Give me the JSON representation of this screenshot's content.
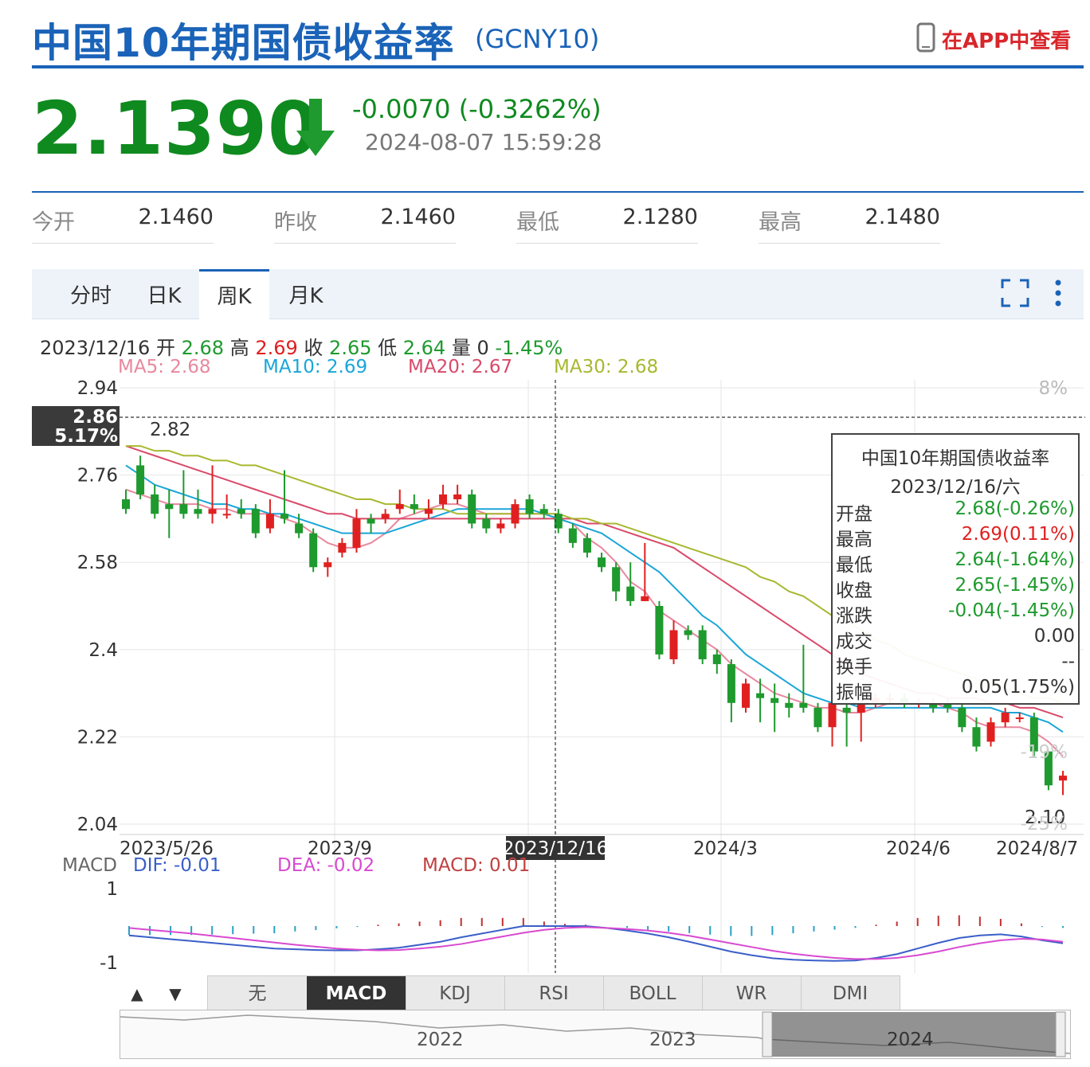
{
  "header": {
    "title": "中国10年期国债收益率",
    "code": "(GCNY10)",
    "app_link": "在APP中查看"
  },
  "quote": {
    "price": "2.1390",
    "direction_icon": "arrow-down-icon",
    "change": "-0.0070 (-0.3262%)",
    "timestamp": "2024-08-07 15:59:28"
  },
  "stats": [
    {
      "label": "今开",
      "value": "2.1460"
    },
    {
      "label": "昨收",
      "value": "2.1460"
    },
    {
      "label": "最低",
      "value": "2.1280"
    },
    {
      "label": "最高",
      "value": "2.1480"
    }
  ],
  "tabs": [
    {
      "label": "分时",
      "active": false
    },
    {
      "label": "日K",
      "active": false
    },
    {
      "label": "周K",
      "active": true
    },
    {
      "label": "月K",
      "active": false
    }
  ],
  "toolbar_icons": [
    "fullscreen-icon",
    "more-vertical-icon"
  ],
  "info_line": {
    "date": "2023/12/16",
    "open_label": "开",
    "open": "2.68",
    "high_label": "高",
    "high": "2.69",
    "close_label": "收",
    "close": "2.65",
    "low_label": "低",
    "low": "2.64",
    "vol_label": "量",
    "vol": "0",
    "pct": "-1.45%"
  },
  "ma_legend": [
    {
      "text": "MA5: 2.68",
      "color": "#e8889e"
    },
    {
      "text": "MA10: 2.69",
      "color": "#1aa6d8"
    },
    {
      "text": "MA20: 2.67",
      "color": "#d94a6a"
    },
    {
      "text": "MA30: 2.68",
      "color": "#a8b830"
    }
  ],
  "colors": {
    "up": "#e02020",
    "down": "#1e9a2e",
    "accent": "#1a63b8"
  },
  "chart_data": {
    "type": "candlestick",
    "y_ticks": [
      "2.94",
      "2.76",
      "2.58",
      "2.4",
      "2.22",
      "2.04"
    ],
    "ylim": [
      2.04,
      2.94
    ],
    "right_pct_labels": [
      "8%",
      "-19%",
      "-25%"
    ],
    "x_labels": [
      "2023/5/26",
      "2023/9",
      "2023/12/16",
      "2024/3",
      "2024/6",
      "2024/8/7"
    ],
    "crosshair": {
      "date": "2023/12/16",
      "value": "2.86",
      "pct": "5.17%"
    },
    "annotations": {
      "max": "2.82",
      "min": "2.10"
    },
    "candles": [
      {
        "o": 2.71,
        "c": 2.69,
        "h": 2.73,
        "l": 2.68
      },
      {
        "o": 2.78,
        "c": 2.72,
        "h": 2.8,
        "l": 2.71
      },
      {
        "o": 2.72,
        "c": 2.68,
        "h": 2.74,
        "l": 2.67
      },
      {
        "o": 2.7,
        "c": 2.69,
        "h": 2.73,
        "l": 2.63
      },
      {
        "o": 2.7,
        "c": 2.68,
        "h": 2.77,
        "l": 2.67
      },
      {
        "o": 2.69,
        "c": 2.68,
        "h": 2.73,
        "l": 2.67
      },
      {
        "o": 2.68,
        "c": 2.69,
        "h": 2.78,
        "l": 2.66
      },
      {
        "o": 2.68,
        "c": 2.68,
        "h": 2.72,
        "l": 2.67
      },
      {
        "o": 2.69,
        "c": 2.68,
        "h": 2.71,
        "l": 2.67
      },
      {
        "o": 2.69,
        "c": 2.64,
        "h": 2.7,
        "l": 2.63
      },
      {
        "o": 2.65,
        "c": 2.68,
        "h": 2.71,
        "l": 2.64
      },
      {
        "o": 2.68,
        "c": 2.67,
        "h": 2.77,
        "l": 2.66
      },
      {
        "o": 2.66,
        "c": 2.64,
        "h": 2.68,
        "l": 2.63
      },
      {
        "o": 2.64,
        "c": 2.57,
        "h": 2.65,
        "l": 2.56
      },
      {
        "o": 2.57,
        "c": 2.58,
        "h": 2.59,
        "l": 2.55
      },
      {
        "o": 2.6,
        "c": 2.62,
        "h": 2.63,
        "l": 2.59
      },
      {
        "o": 2.61,
        "c": 2.67,
        "h": 2.69,
        "l": 2.6
      },
      {
        "o": 2.67,
        "c": 2.66,
        "h": 2.68,
        "l": 2.64
      },
      {
        "o": 2.67,
        "c": 2.68,
        "h": 2.69,
        "l": 2.66
      },
      {
        "o": 2.69,
        "c": 2.7,
        "h": 2.73,
        "l": 2.68
      },
      {
        "o": 2.7,
        "c": 2.69,
        "h": 2.72,
        "l": 2.68
      },
      {
        "o": 2.68,
        "c": 2.69,
        "h": 2.71,
        "l": 2.67
      },
      {
        "o": 2.7,
        "c": 2.72,
        "h": 2.74,
        "l": 2.69
      },
      {
        "o": 2.71,
        "c": 2.72,
        "h": 2.74,
        "l": 2.7
      },
      {
        "o": 2.72,
        "c": 2.66,
        "h": 2.73,
        "l": 2.65
      },
      {
        "o": 2.67,
        "c": 2.65,
        "h": 2.68,
        "l": 2.64
      },
      {
        "o": 2.65,
        "c": 2.66,
        "h": 2.67,
        "l": 2.64
      },
      {
        "o": 2.66,
        "c": 2.7,
        "h": 2.71,
        "l": 2.65
      },
      {
        "o": 2.71,
        "c": 2.68,
        "h": 2.72,
        "l": 2.67
      },
      {
        "o": 2.69,
        "c": 2.68,
        "h": 2.7,
        "l": 2.67
      },
      {
        "o": 2.68,
        "c": 2.65,
        "h": 2.69,
        "l": 2.64
      },
      {
        "o": 2.65,
        "c": 2.62,
        "h": 2.66,
        "l": 2.61
      },
      {
        "o": 2.63,
        "c": 2.6,
        "h": 2.64,
        "l": 2.59
      },
      {
        "o": 2.59,
        "c": 2.57,
        "h": 2.6,
        "l": 2.56
      },
      {
        "o": 2.57,
        "c": 2.52,
        "h": 2.58,
        "l": 2.5
      },
      {
        "o": 2.53,
        "c": 2.5,
        "h": 2.58,
        "l": 2.49
      },
      {
        "o": 2.5,
        "c": 2.51,
        "h": 2.62,
        "l": 2.5
      },
      {
        "o": 2.49,
        "c": 2.39,
        "h": 2.5,
        "l": 2.38
      },
      {
        "o": 2.38,
        "c": 2.44,
        "h": 2.46,
        "l": 2.37
      },
      {
        "o": 2.44,
        "c": 2.43,
        "h": 2.45,
        "l": 2.42
      },
      {
        "o": 2.44,
        "c": 2.38,
        "h": 2.45,
        "l": 2.37
      },
      {
        "o": 2.39,
        "c": 2.37,
        "h": 2.4,
        "l": 2.35
      },
      {
        "o": 2.37,
        "c": 2.29,
        "h": 2.38,
        "l": 2.25
      },
      {
        "o": 2.28,
        "c": 2.33,
        "h": 2.34,
        "l": 2.27
      },
      {
        "o": 2.31,
        "c": 2.3,
        "h": 2.34,
        "l": 2.25
      },
      {
        "o": 2.3,
        "c": 2.29,
        "h": 2.33,
        "l": 2.23
      },
      {
        "o": 2.29,
        "c": 2.28,
        "h": 2.31,
        "l": 2.26
      },
      {
        "o": 2.29,
        "c": 2.28,
        "h": 2.41,
        "l": 2.27
      },
      {
        "o": 2.28,
        "c": 2.24,
        "h": 2.29,
        "l": 2.23
      },
      {
        "o": 2.24,
        "c": 2.29,
        "h": 2.3,
        "l": 2.2
      },
      {
        "o": 2.28,
        "c": 2.27,
        "h": 2.3,
        "l": 2.2
      },
      {
        "o": 2.27,
        "c": 2.29,
        "h": 2.31,
        "l": 2.21
      },
      {
        "o": 2.29,
        "c": 2.3,
        "h": 2.31,
        "l": 2.28
      },
      {
        "o": 2.3,
        "c": 2.3,
        "h": 2.31,
        "l": 2.29
      },
      {
        "o": 2.3,
        "c": 2.29,
        "h": 2.31,
        "l": 2.28
      },
      {
        "o": 2.29,
        "c": 2.29,
        "h": 2.3,
        "l": 2.28
      },
      {
        "o": 2.29,
        "c": 2.28,
        "h": 2.3,
        "l": 2.27
      },
      {
        "o": 2.29,
        "c": 2.28,
        "h": 2.3,
        "l": 2.27
      },
      {
        "o": 2.28,
        "c": 2.24,
        "h": 2.29,
        "l": 2.23
      },
      {
        "o": 2.24,
        "c": 2.2,
        "h": 2.26,
        "l": 2.19
      },
      {
        "o": 2.21,
        "c": 2.25,
        "h": 2.26,
        "l": 2.2
      },
      {
        "o": 2.25,
        "c": 2.27,
        "h": 2.28,
        "l": 2.24
      },
      {
        "o": 2.26,
        "c": 2.26,
        "h": 2.27,
        "l": 2.25
      },
      {
        "o": 2.26,
        "c": 2.19,
        "h": 2.27,
        "l": 2.18
      },
      {
        "o": 2.19,
        "c": 2.12,
        "h": 2.19,
        "l": 2.11
      },
      {
        "o": 2.13,
        "c": 2.14,
        "h": 2.15,
        "l": 2.1
      }
    ],
    "ma_series": {
      "MA5": [
        2.73,
        2.72,
        2.71,
        2.7,
        2.7,
        2.7,
        2.69,
        2.69,
        2.68,
        2.68,
        2.68,
        2.67,
        2.66,
        2.64,
        2.62,
        2.61,
        2.61,
        2.62,
        2.64,
        2.67,
        2.68,
        2.69,
        2.7,
        2.7,
        2.69,
        2.68,
        2.68,
        2.68,
        2.68,
        2.68,
        2.67,
        2.66,
        2.63,
        2.61,
        2.58,
        2.54,
        2.52,
        2.48,
        2.46,
        2.44,
        2.42,
        2.4,
        2.37,
        2.35,
        2.33,
        2.31,
        2.3,
        2.29,
        2.28,
        2.28,
        2.27,
        2.27,
        2.28,
        2.29,
        2.29,
        2.29,
        2.29,
        2.28,
        2.27,
        2.25,
        2.24,
        2.24,
        2.24,
        2.23,
        2.21,
        2.18
      ],
      "MA10": [
        2.78,
        2.76,
        2.74,
        2.73,
        2.72,
        2.71,
        2.7,
        2.7,
        2.69,
        2.69,
        2.68,
        2.68,
        2.67,
        2.66,
        2.65,
        2.64,
        2.64,
        2.64,
        2.64,
        2.65,
        2.66,
        2.67,
        2.68,
        2.69,
        2.69,
        2.69,
        2.69,
        2.69,
        2.69,
        2.68,
        2.67,
        2.66,
        2.65,
        2.64,
        2.62,
        2.6,
        2.58,
        2.56,
        2.53,
        2.5,
        2.47,
        2.45,
        2.42,
        2.39,
        2.37,
        2.35,
        2.33,
        2.31,
        2.3,
        2.29,
        2.29,
        2.28,
        2.28,
        2.28,
        2.28,
        2.28,
        2.28,
        2.28,
        2.28,
        2.28,
        2.28,
        2.27,
        2.27,
        2.26,
        2.25,
        2.23
      ],
      "MA20": [
        2.82,
        2.81,
        2.8,
        2.79,
        2.78,
        2.77,
        2.76,
        2.75,
        2.74,
        2.73,
        2.72,
        2.71,
        2.7,
        2.69,
        2.68,
        2.68,
        2.67,
        2.67,
        2.67,
        2.67,
        2.67,
        2.67,
        2.67,
        2.67,
        2.67,
        2.67,
        2.67,
        2.67,
        2.67,
        2.67,
        2.67,
        2.67,
        2.66,
        2.66,
        2.65,
        2.64,
        2.63,
        2.62,
        2.61,
        2.59,
        2.57,
        2.55,
        2.53,
        2.51,
        2.49,
        2.47,
        2.45,
        2.43,
        2.41,
        2.39,
        2.37,
        2.35,
        2.34,
        2.33,
        2.32,
        2.31,
        2.31,
        2.3,
        2.3,
        2.3,
        2.29,
        2.29,
        2.28,
        2.28,
        2.27,
        2.26
      ],
      "MA30": [
        2.82,
        2.82,
        2.81,
        2.81,
        2.8,
        2.8,
        2.79,
        2.79,
        2.78,
        2.78,
        2.77,
        2.76,
        2.75,
        2.74,
        2.73,
        2.72,
        2.71,
        2.71,
        2.7,
        2.7,
        2.69,
        2.69,
        2.69,
        2.68,
        2.68,
        2.68,
        2.68,
        2.68,
        2.68,
        2.68,
        2.68,
        2.67,
        2.67,
        2.66,
        2.66,
        2.65,
        2.64,
        2.63,
        2.62,
        2.61,
        2.6,
        2.59,
        2.58,
        2.57,
        2.55,
        2.54,
        2.52,
        2.51,
        2.49,
        2.47,
        2.46,
        2.44,
        2.42,
        2.41,
        2.39,
        2.38,
        2.37,
        2.36,
        2.35,
        2.34,
        2.33,
        2.32,
        2.31,
        2.3,
        2.3,
        2.29
      ]
    }
  },
  "tooltip": {
    "title": "中国10年期国债收益率",
    "date": "2023/12/16/六",
    "rows": [
      {
        "label": "开盘",
        "value": "2.68(-0.26%)",
        "color": "#1e9a2e"
      },
      {
        "label": "最高",
        "value": "2.69(0.11%)",
        "color": "#e02020"
      },
      {
        "label": "最低",
        "value": "2.64(-1.64%)",
        "color": "#1e9a2e"
      },
      {
        "label": "收盘",
        "value": "2.65(-1.45%)",
        "color": "#1e9a2e"
      },
      {
        "label": "涨跌",
        "value": "-0.04(-1.45%)",
        "color": "#1e9a2e"
      },
      {
        "label": "成交",
        "value": "0.00",
        "color": "#333333"
      },
      {
        "label": "换手",
        "value": "--",
        "color": "#333333"
      },
      {
        "label": "振幅",
        "value": "0.05(1.75%)",
        "color": "#333333"
      }
    ]
  },
  "macd": {
    "label": "MACD",
    "dif": "DIF: -0.01",
    "dea": "DEA: -0.02",
    "macd": "MACD: 0.01",
    "y_ticks": [
      "1",
      "-1"
    ],
    "dif_series": [
      -0.25,
      -0.3,
      -0.35,
      -0.4,
      -0.45,
      -0.5,
      -0.55,
      -0.6,
      -0.62,
      -0.64,
      -0.65,
      -0.65,
      -0.62,
      -0.58,
      -0.5,
      -0.42,
      -0.3,
      -0.2,
      -0.1,
      0.0,
      0.0,
      0.0,
      0.0,
      -0.05,
      -0.12,
      -0.2,
      -0.3,
      -0.42,
      -0.55,
      -0.68,
      -0.78,
      -0.86,
      -0.9,
      -0.92,
      -0.93,
      -0.92,
      -0.85,
      -0.75,
      -0.6,
      -0.45,
      -0.32,
      -0.25,
      -0.22,
      -0.28,
      -0.38,
      -0.46
    ],
    "dea_series": [
      -0.05,
      -0.1,
      -0.15,
      -0.2,
      -0.26,
      -0.32,
      -0.38,
      -0.44,
      -0.5,
      -0.55,
      -0.6,
      -0.63,
      -0.65,
      -0.64,
      -0.6,
      -0.55,
      -0.48,
      -0.38,
      -0.28,
      -0.18,
      -0.1,
      -0.05,
      -0.03,
      -0.05,
      -0.08,
      -0.12,
      -0.18,
      -0.26,
      -0.36,
      -0.46,
      -0.56,
      -0.66,
      -0.74,
      -0.8,
      -0.85,
      -0.88,
      -0.88,
      -0.85,
      -0.78,
      -0.68,
      -0.56,
      -0.46,
      -0.38,
      -0.34,
      -0.36,
      -0.42
    ],
    "hist_series": [
      -0.4,
      -0.4,
      -0.4,
      -0.4,
      -0.38,
      -0.36,
      -0.34,
      -0.32,
      -0.24,
      -0.18,
      -0.1,
      -0.04,
      0.06,
      0.12,
      0.2,
      0.26,
      0.36,
      0.36,
      0.36,
      0.36,
      0.2,
      0.1,
      0.06,
      0.0,
      -0.08,
      -0.16,
      -0.24,
      -0.32,
      -0.38,
      -0.44,
      -0.44,
      -0.4,
      -0.32,
      -0.24,
      -0.16,
      -0.08,
      0.06,
      0.2,
      0.36,
      0.46,
      0.48,
      0.42,
      0.32,
      0.12,
      -0.04,
      -0.08
    ]
  },
  "bottom_tabs": [
    {
      "label": "无",
      "active": false
    },
    {
      "label": "MACD",
      "active": true
    },
    {
      "label": "KDJ",
      "active": false
    },
    {
      "label": "RSI",
      "active": false
    },
    {
      "label": "BOLL",
      "active": false
    },
    {
      "label": "WR",
      "active": false
    },
    {
      "label": "DMI",
      "active": false
    }
  ],
  "navigator": {
    "year_labels": [
      "2022",
      "2023",
      "2024"
    ]
  }
}
